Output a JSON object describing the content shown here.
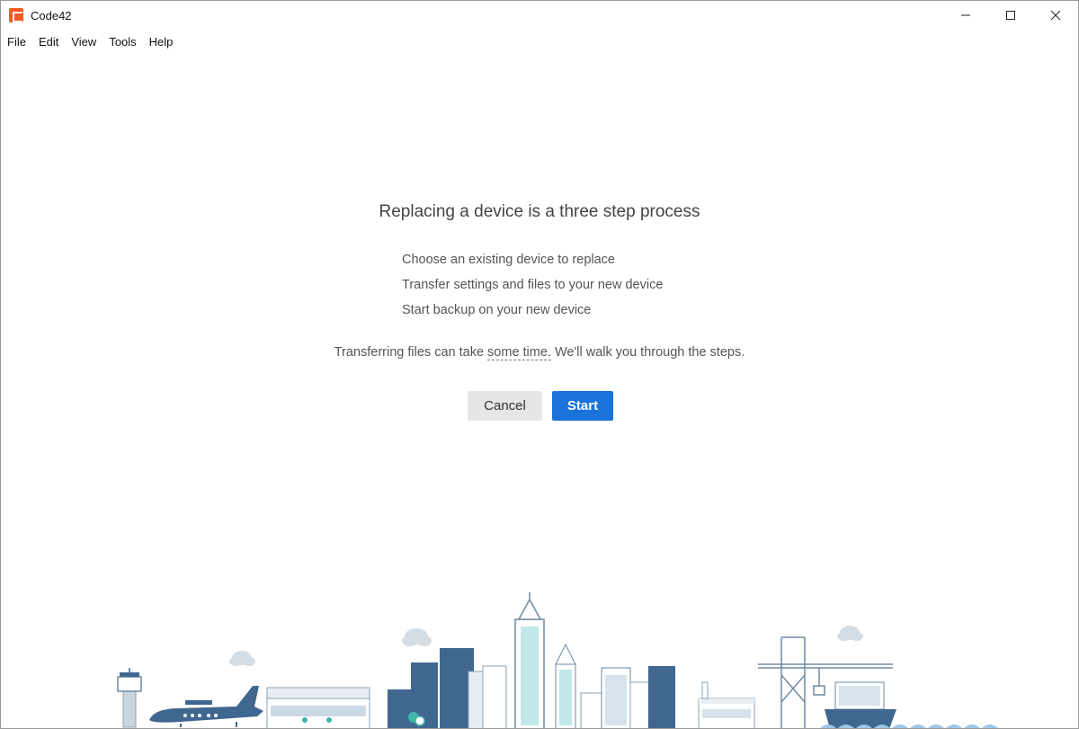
{
  "window": {
    "title": "Code42",
    "icon": "code42-logo-icon",
    "controls": [
      "minimize-icon",
      "maximize-icon",
      "close-icon"
    ]
  },
  "menu": {
    "items": [
      "File",
      "Edit",
      "View",
      "Tools",
      "Help"
    ]
  },
  "dialog": {
    "heading": "Replacing a device is a three step process",
    "steps": [
      "Choose an existing device to replace",
      "Transfer settings and files to your new device",
      "Start backup on your new device"
    ],
    "note_before": "Transferring files can take ",
    "note_link": "some time.",
    "note_after": " We'll walk you through the steps.",
    "cancel_label": "Cancel",
    "start_label": "Start"
  },
  "colors": {
    "accent": "#1a73d9",
    "brand": "#f05a23",
    "skyline_dark": "#3f6790",
    "skyline_light": "#d7e3ec",
    "water": "#9cc7e6"
  }
}
